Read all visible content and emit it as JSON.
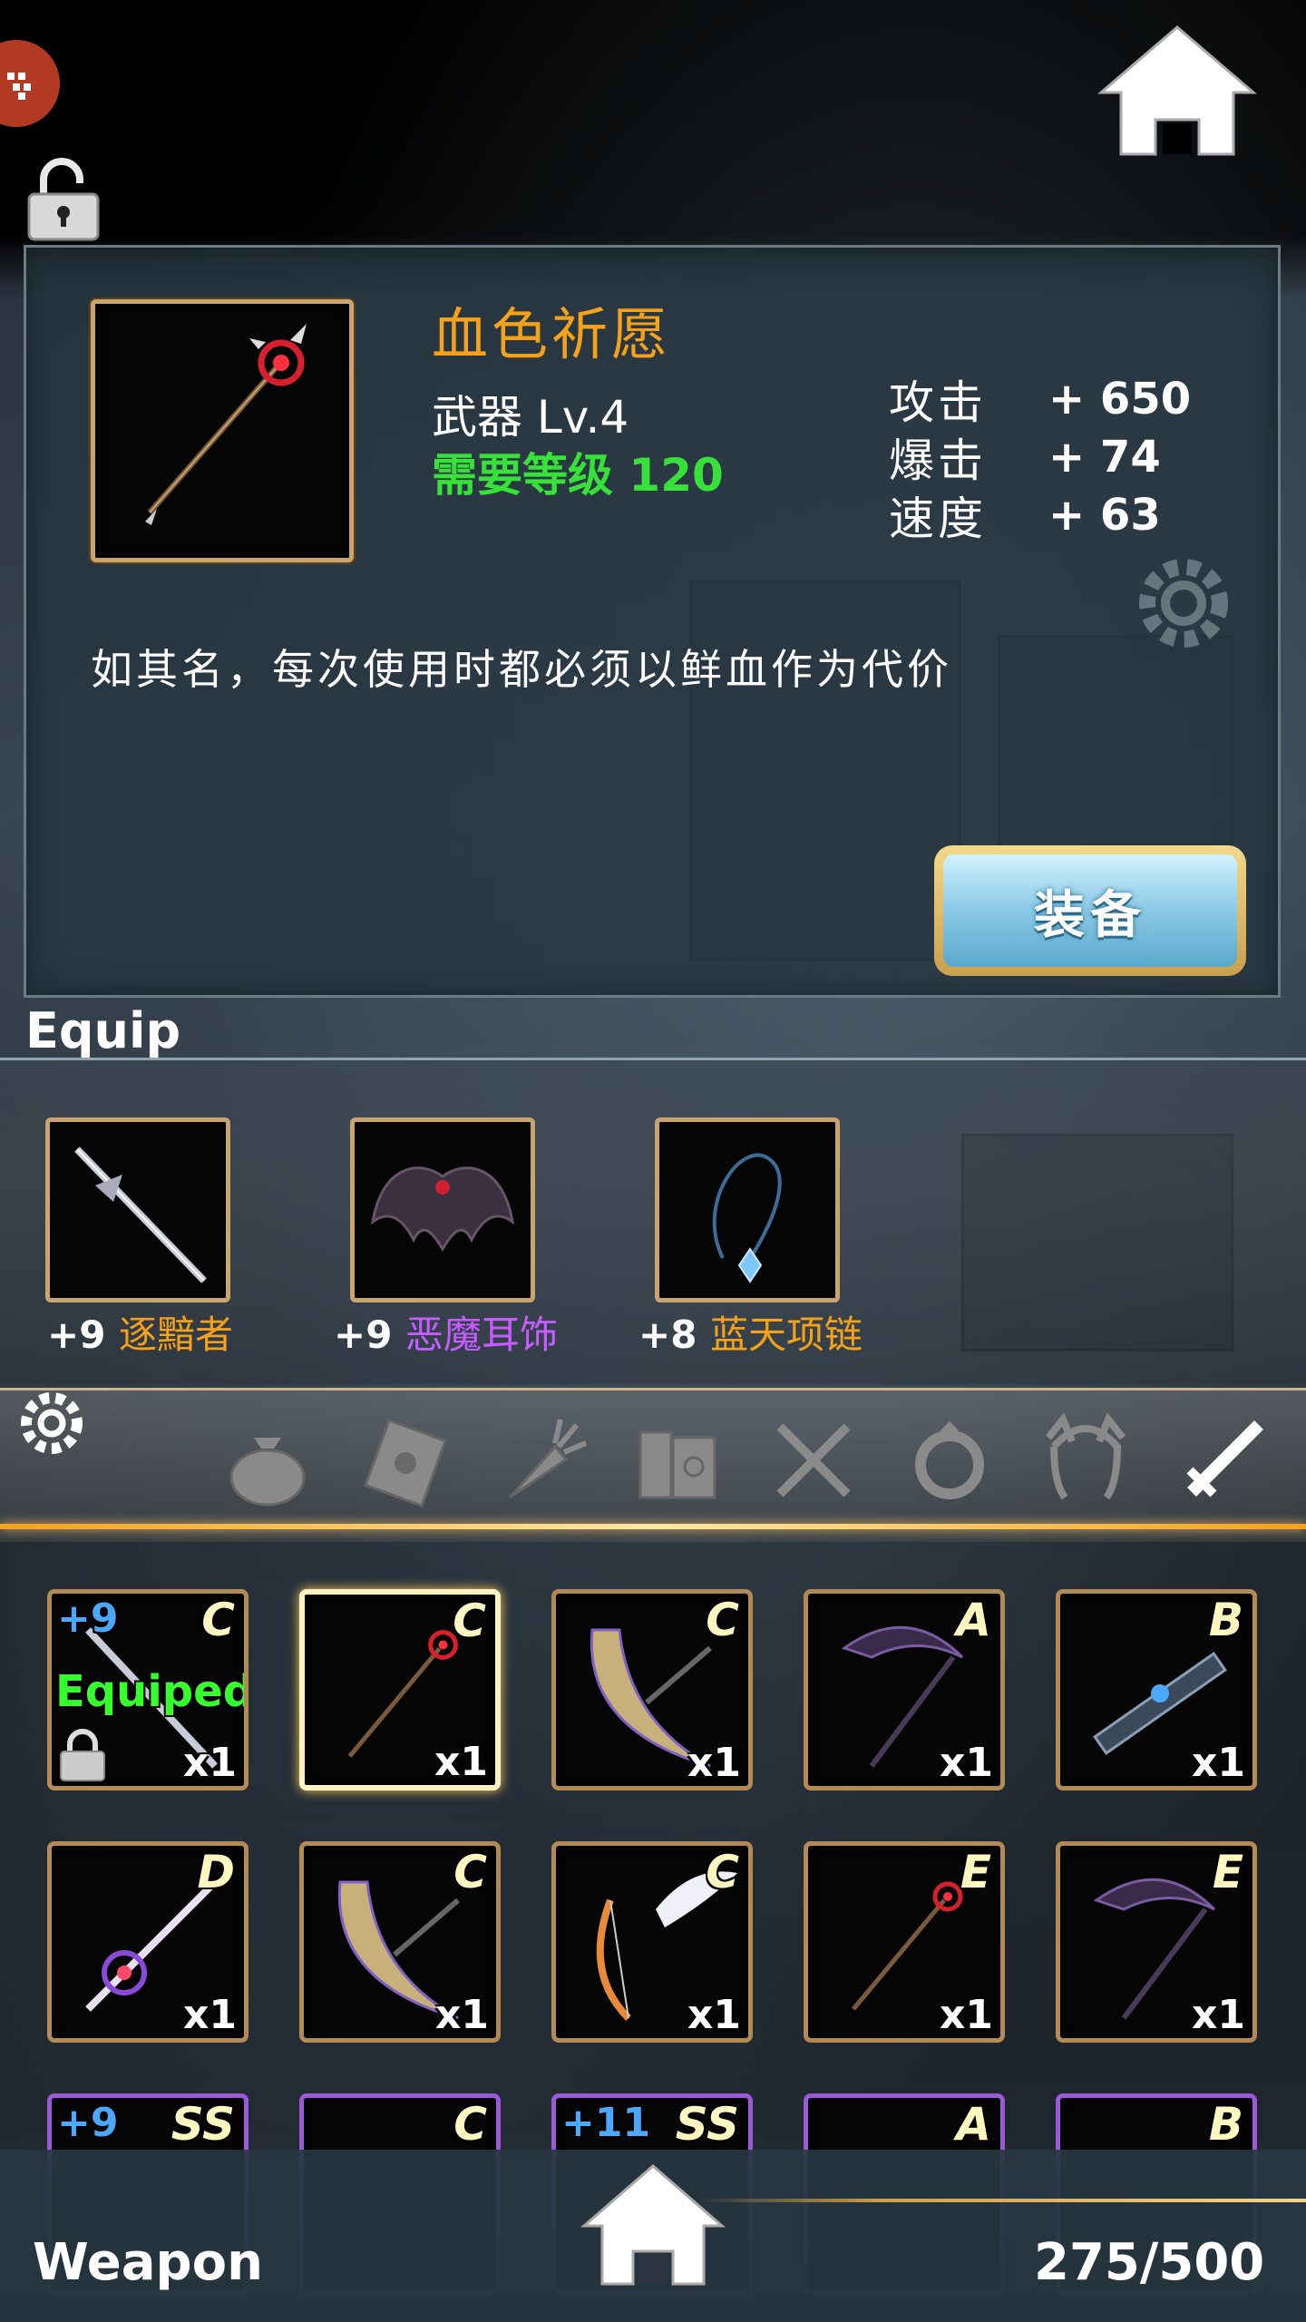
{
  "detail": {
    "name": "血色祈愿",
    "type_level": "武器 Lv.4",
    "required_level": "需要等级 120",
    "stats": [
      {
        "name": "攻击",
        "value": "+ 650"
      },
      {
        "name": "爆击",
        "value": "+ 74"
      },
      {
        "name": "速度",
        "value": "+ 63"
      }
    ],
    "description": "如其名，每次使用时都必须以鲜血作为代价",
    "equip_button": "装备"
  },
  "equip": {
    "title": "Equip",
    "items": [
      {
        "plus": "+9",
        "name": "逐黯者",
        "color": "#f4a21a",
        "icon": "sword-icon"
      },
      {
        "plus": "+9",
        "name": "恶魔耳饰",
        "color": "#c55cff",
        "icon": "bat-wing-earring-icon"
      },
      {
        "plus": "+8",
        "name": "蓝天项链",
        "color": "#f4a21a",
        "icon": "blue-necklace-icon"
      }
    ]
  },
  "tabs": [
    {
      "icon": "bag-icon"
    },
    {
      "icon": "scroll-icon"
    },
    {
      "icon": "carrot-icon"
    },
    {
      "icon": "books-icon"
    },
    {
      "icon": "utensils-icon"
    },
    {
      "icon": "ring-icon"
    },
    {
      "icon": "cat-ears-icon"
    },
    {
      "icon": "sword-tab-icon",
      "active": true
    }
  ],
  "inventory": {
    "rows": [
      [
        {
          "grade": "C",
          "qty": "x1",
          "plus": "+9",
          "status": "Equiped",
          "locked": true,
          "icon": "sword-icon"
        },
        {
          "grade": "C",
          "qty": "x1",
          "selected": true,
          "icon": "red-staff-icon"
        },
        {
          "grade": "C",
          "qty": "x1",
          "icon": "crescent-bow-icon"
        },
        {
          "grade": "A",
          "qty": "x1",
          "icon": "scythe-icon"
        },
        {
          "grade": "B",
          "qty": "x1",
          "icon": "gun-icon"
        }
      ],
      [
        {
          "grade": "D",
          "qty": "x1",
          "icon": "purple-staff-icon"
        },
        {
          "grade": "C",
          "qty": "x1",
          "icon": "crescent-bow-icon"
        },
        {
          "grade": "C",
          "qty": "x1",
          "icon": "winged-bow-icon"
        },
        {
          "grade": "E",
          "qty": "x1",
          "icon": "red-staff-icon"
        },
        {
          "grade": "E",
          "qty": "x1",
          "icon": "scythe-icon"
        }
      ],
      [
        {
          "grade": "SS",
          "plus": "+9",
          "icon": "weapon-icon"
        },
        {
          "grade": "C",
          "icon": "weapon-icon"
        },
        {
          "grade": "SS",
          "plus": "+11",
          "icon": "weapon-icon"
        },
        {
          "grade": "A",
          "icon": "weapon-icon"
        },
        {
          "grade": "B",
          "icon": "weapon-icon"
        }
      ]
    ]
  },
  "bottom": {
    "category": "Weapon",
    "count": "275/500"
  }
}
